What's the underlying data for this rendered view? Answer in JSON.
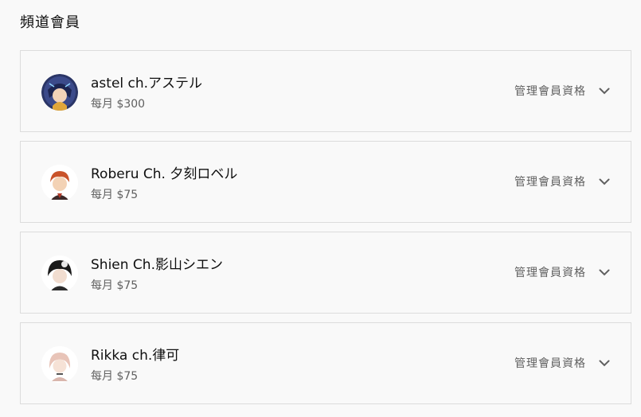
{
  "section": {
    "title": "頻道會員"
  },
  "memberships": [
    {
      "channel_name": "astel ch.アステル",
      "price": "每月 $300",
      "manage_label": "管理會員資格",
      "avatar_icon": "avatar-astel-icon"
    },
    {
      "channel_name": "Roberu Ch. 夕刻ロベル",
      "price": "每月 $75",
      "manage_label": "管理會員資格",
      "avatar_icon": "avatar-roberu-icon"
    },
    {
      "channel_name": "Shien Ch.影山シエン",
      "price": "每月 $75",
      "manage_label": "管理會員資格",
      "avatar_icon": "avatar-shien-icon"
    },
    {
      "channel_name": "Rikka ch.律可",
      "price": "每月 $75",
      "manage_label": "管理會員資格",
      "avatar_icon": "avatar-rikka-icon"
    }
  ],
  "colors": {
    "background": "#f9f9f9",
    "border": "#dcdcdc",
    "primary_text": "#0f0f0f",
    "secondary_text": "#606060"
  }
}
